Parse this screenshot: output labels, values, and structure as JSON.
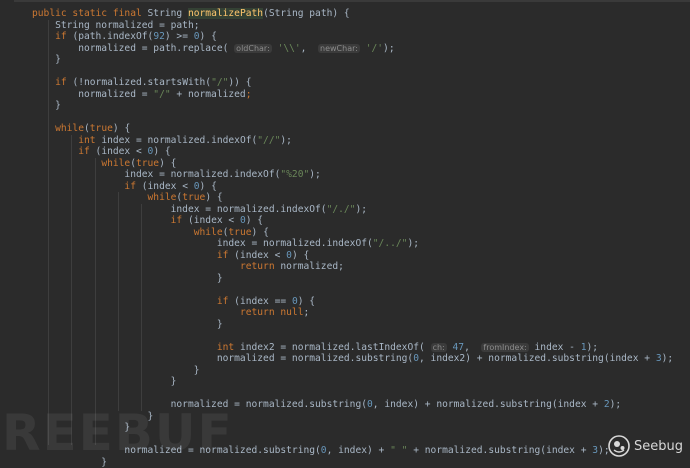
{
  "editor": {
    "lines": [
      {
        "tokens": [
          {
            "t": "public static final ",
            "c": "kw"
          },
          {
            "t": "String "
          },
          {
            "t": "normalizePath",
            "c": "fnhl"
          },
          {
            "t": "(String path) {"
          }
        ]
      },
      {
        "tokens": [
          {
            "t": "    String normalized = path;"
          }
        ]
      },
      {
        "tokens": [
          {
            "t": "    "
          },
          {
            "t": "if",
            "c": "kw"
          },
          {
            "t": " (path.indexOf("
          },
          {
            "t": "92",
            "c": "num"
          },
          {
            "t": ") >= "
          },
          {
            "t": "0",
            "c": "num"
          },
          {
            "t": ") {"
          }
        ]
      },
      {
        "tokens": [
          {
            "t": "        normalized = path.replace( "
          },
          {
            "t": "oldChar:",
            "c": "hint"
          },
          {
            "t": " "
          },
          {
            "t": "'\\\\'",
            "c": "str"
          },
          {
            "t": ",  "
          },
          {
            "t": "newChar:",
            "c": "hint"
          },
          {
            "t": " "
          },
          {
            "t": "'/'",
            "c": "str"
          },
          {
            "t": ");"
          }
        ]
      },
      {
        "tokens": [
          {
            "t": "    }"
          }
        ]
      },
      {
        "tokens": []
      },
      {
        "tokens": [
          {
            "t": "    "
          },
          {
            "t": "if",
            "c": "kw"
          },
          {
            "t": " (!normalized.startsWith("
          },
          {
            "t": "\"/\"",
            "c": "str"
          },
          {
            "t": ")) {"
          }
        ]
      },
      {
        "tokens": [
          {
            "t": "        normalized = "
          },
          {
            "t": "\"/\"",
            "c": "str"
          },
          {
            "t": " + normalized"
          },
          {
            "t": ";",
            "c": "kw"
          }
        ]
      },
      {
        "tokens": [
          {
            "t": "    }"
          }
        ]
      },
      {
        "tokens": []
      },
      {
        "tokens": [
          {
            "t": "    "
          },
          {
            "t": "while",
            "c": "kw"
          },
          {
            "t": "("
          },
          {
            "t": "true",
            "c": "kw"
          },
          {
            "t": ") {"
          }
        ]
      },
      {
        "tokens": [
          {
            "t": "        "
          },
          {
            "t": "int",
            "c": "kw"
          },
          {
            "t": " index = normalized.indexOf("
          },
          {
            "t": "\"//\"",
            "c": "str"
          },
          {
            "t": ");"
          }
        ]
      },
      {
        "tokens": [
          {
            "t": "        "
          },
          {
            "t": "if",
            "c": "kw"
          },
          {
            "t": " (index < "
          },
          {
            "t": "0",
            "c": "num"
          },
          {
            "t": ") {"
          }
        ]
      },
      {
        "tokens": [
          {
            "t": "            "
          },
          {
            "t": "while",
            "c": "kw"
          },
          {
            "t": "("
          },
          {
            "t": "true",
            "c": "kw"
          },
          {
            "t": ") {"
          }
        ]
      },
      {
        "tokens": [
          {
            "t": "                index = normalized.indexOf("
          },
          {
            "t": "\"%20\"",
            "c": "str"
          },
          {
            "t": ");"
          }
        ]
      },
      {
        "tokens": [
          {
            "t": "                "
          },
          {
            "t": "if",
            "c": "kw"
          },
          {
            "t": " (index < "
          },
          {
            "t": "0",
            "c": "num"
          },
          {
            "t": ") {"
          }
        ]
      },
      {
        "tokens": [
          {
            "t": "                    "
          },
          {
            "t": "while",
            "c": "kw"
          },
          {
            "t": "("
          },
          {
            "t": "true",
            "c": "kw"
          },
          {
            "t": ") {"
          }
        ]
      },
      {
        "tokens": [
          {
            "t": "                        index = normalized.indexOf("
          },
          {
            "t": "\"/./\"",
            "c": "str"
          },
          {
            "t": ");"
          }
        ]
      },
      {
        "tokens": [
          {
            "t": "                        "
          },
          {
            "t": "if",
            "c": "kw"
          },
          {
            "t": " (index < "
          },
          {
            "t": "0",
            "c": "num"
          },
          {
            "t": ") {"
          }
        ]
      },
      {
        "tokens": [
          {
            "t": "                            "
          },
          {
            "t": "while",
            "c": "kw"
          },
          {
            "t": "("
          },
          {
            "t": "true",
            "c": "kw"
          },
          {
            "t": ") {"
          }
        ]
      },
      {
        "tokens": [
          {
            "t": "                                index = normalized.indexOf("
          },
          {
            "t": "\"/../\"",
            "c": "str"
          },
          {
            "t": ");"
          }
        ]
      },
      {
        "tokens": [
          {
            "t": "                                "
          },
          {
            "t": "if",
            "c": "kw"
          },
          {
            "t": " (index < "
          },
          {
            "t": "0",
            "c": "num"
          },
          {
            "t": ") {"
          }
        ]
      },
      {
        "tokens": [
          {
            "t": "                                    "
          },
          {
            "t": "return",
            "c": "kw"
          },
          {
            "t": " normalized;"
          }
        ]
      },
      {
        "tokens": [
          {
            "t": "                                }"
          }
        ]
      },
      {
        "tokens": []
      },
      {
        "tokens": [
          {
            "t": "                                "
          },
          {
            "t": "if",
            "c": "kw"
          },
          {
            "t": " (index == "
          },
          {
            "t": "0",
            "c": "num"
          },
          {
            "t": ") {"
          }
        ]
      },
      {
        "tokens": [
          {
            "t": "                                    "
          },
          {
            "t": "return null",
            "c": "kw"
          },
          {
            "t": ";"
          }
        ]
      },
      {
        "tokens": [
          {
            "t": "                                }"
          }
        ]
      },
      {
        "tokens": []
      },
      {
        "tokens": [
          {
            "t": "                                "
          },
          {
            "t": "int",
            "c": "kw"
          },
          {
            "t": " index2 = normalized.lastIndexOf( "
          },
          {
            "t": "ch:",
            "c": "hint"
          },
          {
            "t": " "
          },
          {
            "t": "47",
            "c": "num"
          },
          {
            "t": ",  "
          },
          {
            "t": "fromIndex:",
            "c": "hint"
          },
          {
            "t": " index - "
          },
          {
            "t": "1",
            "c": "num"
          },
          {
            "t": ");"
          }
        ]
      },
      {
        "tokens": [
          {
            "t": "                                normalized = normalized.substring("
          },
          {
            "t": "0",
            "c": "num"
          },
          {
            "t": ", index2) + normalized.substring(index + "
          },
          {
            "t": "3",
            "c": "num"
          },
          {
            "t": ");"
          }
        ]
      },
      {
        "tokens": [
          {
            "t": "                            }"
          }
        ]
      },
      {
        "tokens": [
          {
            "t": "                        }"
          }
        ]
      },
      {
        "tokens": []
      },
      {
        "tokens": [
          {
            "t": "                        normalized = normalized.substring("
          },
          {
            "t": "0",
            "c": "num"
          },
          {
            "t": ", index) + normalized.substring(index + "
          },
          {
            "t": "2",
            "c": "num"
          },
          {
            "t": ");"
          }
        ]
      },
      {
        "tokens": [
          {
            "t": "                    }"
          }
        ]
      },
      {
        "tokens": [
          {
            "t": "                }"
          }
        ]
      },
      {
        "tokens": []
      },
      {
        "tokens": [
          {
            "t": "                normalized = normalized.substring("
          },
          {
            "t": "0",
            "c": "num"
          },
          {
            "t": ", index) + "
          },
          {
            "t": "\" \"",
            "c": "str"
          },
          {
            "t": " + normalized.substring(index + "
          },
          {
            "t": "3",
            "c": "num"
          },
          {
            "t": ");"
          }
        ]
      },
      {
        "tokens": [
          {
            "t": "            }"
          }
        ]
      }
    ]
  },
  "watermark": {
    "left_text": "REEBUF",
    "right_text": "Seebug",
    "icon": "seebug-icon"
  },
  "colors": {
    "background": "#2b2b2b",
    "default_text": "#a9b7c6",
    "keyword": "#cc7832",
    "number": "#6897bb",
    "string": "#6a8759",
    "method_name": "#ffc66d",
    "param_hint": "#8c8c8c"
  }
}
